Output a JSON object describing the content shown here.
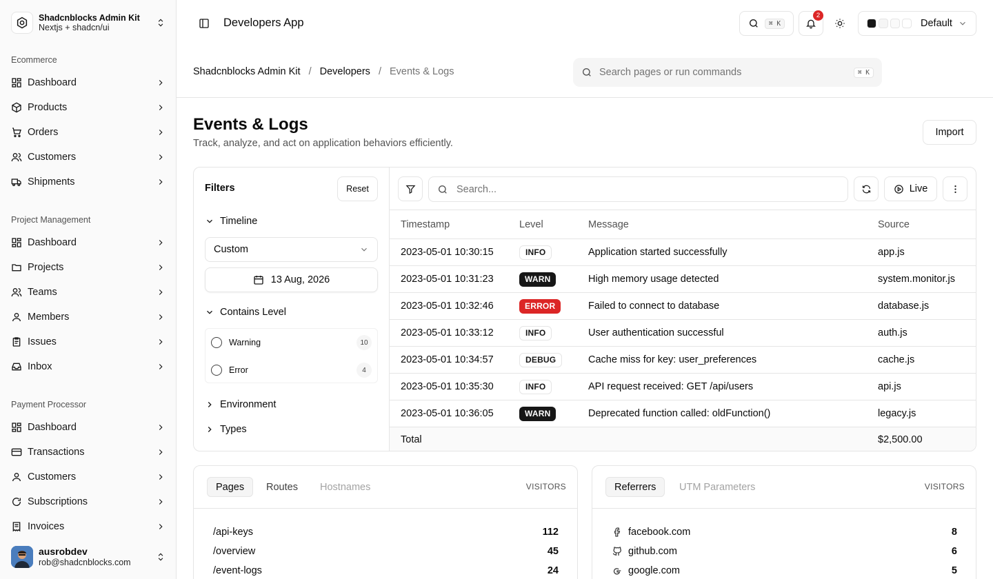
{
  "brand": {
    "name": "Shadcnblocks Admin Kit",
    "subtitle": "Nextjs + shadcn/ui"
  },
  "sidebar": {
    "groups": [
      {
        "label": "Ecommerce",
        "items": [
          {
            "label": "Dashboard",
            "icon": "grid-icon"
          },
          {
            "label": "Products",
            "icon": "package-icon"
          },
          {
            "label": "Orders",
            "icon": "cart-icon"
          },
          {
            "label": "Customers",
            "icon": "users-icon"
          },
          {
            "label": "Shipments",
            "icon": "truck-icon"
          }
        ]
      },
      {
        "label": "Project Management",
        "items": [
          {
            "label": "Dashboard",
            "icon": "grid-icon"
          },
          {
            "label": "Projects",
            "icon": "folder-icon"
          },
          {
            "label": "Teams",
            "icon": "users-icon"
          },
          {
            "label": "Members",
            "icon": "user-icon"
          },
          {
            "label": "Issues",
            "icon": "clipboard-icon"
          },
          {
            "label": "Inbox",
            "icon": "inbox-icon"
          }
        ]
      },
      {
        "label": "Payment Processor",
        "items": [
          {
            "label": "Dashboard",
            "icon": "grid-icon"
          },
          {
            "label": "Transactions",
            "icon": "credit-card-icon"
          },
          {
            "label": "Customers",
            "icon": "user-icon"
          },
          {
            "label": "Subscriptions",
            "icon": "refresh-icon"
          },
          {
            "label": "Invoices",
            "icon": "receipt-icon"
          }
        ]
      }
    ],
    "user": {
      "name": "ausrobdev",
      "email": "rob@shadcnblocks.com"
    }
  },
  "header": {
    "app_title": "Developers App",
    "search_kbd": "⌘ K",
    "notifications_count": "2",
    "theme_label": "Default"
  },
  "breadcrumb": {
    "root": "Shadcnblocks Admin Kit",
    "section": "Developers",
    "current": "Events & Logs",
    "sep": "/"
  },
  "command_search": {
    "placeholder": "Search pages or run commands",
    "kbd": "⌘ K"
  },
  "page": {
    "title": "Events & Logs",
    "subtitle": "Track, analyze, and act on application behaviors efficiently.",
    "import_label": "Import"
  },
  "filters": {
    "title": "Filters",
    "reset_label": "Reset",
    "timeline_label": "Timeline",
    "timeline_value": "Custom",
    "date_value": "13 Aug, 2026",
    "level_label": "Contains Level",
    "levels": [
      {
        "label": "Warning",
        "count": "10"
      },
      {
        "label": "Error",
        "count": "4"
      }
    ],
    "environment_label": "Environment",
    "types_label": "Types"
  },
  "logs": {
    "search_placeholder": "Search...",
    "live_label": "Live",
    "columns": {
      "timestamp": "Timestamp",
      "level": "Level",
      "message": "Message",
      "source": "Source"
    },
    "rows": [
      {
        "timestamp": "2023-05-01 10:30:15",
        "level": "INFO",
        "message": "Application started successfully",
        "source": "app.js"
      },
      {
        "timestamp": "2023-05-01 10:31:23",
        "level": "WARN",
        "message": "High memory usage detected",
        "source": "system.monitor.js"
      },
      {
        "timestamp": "2023-05-01 10:32:46",
        "level": "ERROR",
        "message": "Failed to connect to database",
        "source": "database.js"
      },
      {
        "timestamp": "2023-05-01 10:33:12",
        "level": "INFO",
        "message": "User authentication successful",
        "source": "auth.js"
      },
      {
        "timestamp": "2023-05-01 10:34:57",
        "level": "DEBUG",
        "message": "Cache miss for key: user_preferences",
        "source": "cache.js"
      },
      {
        "timestamp": "2023-05-01 10:35:30",
        "level": "INFO",
        "message": "API request received: GET /api/users",
        "source": "api.js"
      },
      {
        "timestamp": "2023-05-01 10:36:05",
        "level": "WARN",
        "message": "Deprecated function called: oldFunction()",
        "source": "legacy.js"
      }
    ],
    "total_label": "Total",
    "total_value": "$2,500.00"
  },
  "pages_card": {
    "tabs": [
      "Pages",
      "Routes",
      "Hostnames"
    ],
    "visitors_label": "VISITORS",
    "rows": [
      {
        "path": "/api-keys",
        "value": "112"
      },
      {
        "path": "/overview",
        "value": "45"
      },
      {
        "path": "/event-logs",
        "value": "24"
      }
    ]
  },
  "referrers_card": {
    "tabs": [
      "Referrers",
      "UTM Parameters"
    ],
    "visitors_label": "VISITORS",
    "rows": [
      {
        "site": "facebook.com",
        "value": "8",
        "icon": "facebook-icon"
      },
      {
        "site": "github.com",
        "value": "6",
        "icon": "github-icon"
      },
      {
        "site": "google.com",
        "value": "5",
        "icon": "google-icon"
      }
    ]
  },
  "colors": {
    "error": "#dc2626",
    "warn": "#171717",
    "border": "#e5e5e5",
    "sidebar_bg": "#fafafa"
  }
}
